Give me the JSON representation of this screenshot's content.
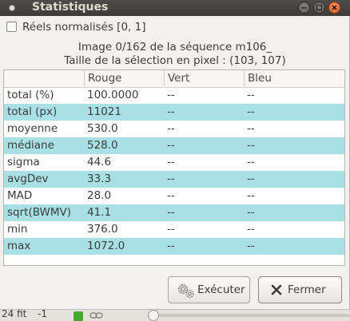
{
  "window": {
    "title": "Statistiques"
  },
  "options": {
    "normalized_label": "Réels normalisés [0, 1]",
    "normalized_checked": false
  },
  "info": {
    "image_line": "Image 0/162 de la séquence m106_",
    "selection_line": "Taille de la sélection en pixel : (103, 107)"
  },
  "table": {
    "headers": [
      "",
      "Rouge",
      "Vert",
      "Bleu"
    ],
    "rows": [
      [
        "total (%)",
        "100.0000",
        "--",
        "--"
      ],
      [
        "total (px)",
        "11021",
        "--",
        "--"
      ],
      [
        "moyenne",
        "530.0",
        "--",
        "--"
      ],
      [
        "médiane",
        "528.0",
        "--",
        "--"
      ],
      [
        "sigma",
        "44.6",
        "--",
        "--"
      ],
      [
        "avgDev",
        "33.3",
        "--",
        "--"
      ],
      [
        "MAD",
        "28.0",
        "--",
        "--"
      ],
      [
        "sqrt(BWMV)",
        "41.1",
        "--",
        "--"
      ],
      [
        "min",
        "376.0",
        "--",
        "--"
      ],
      [
        "max",
        "1072.0",
        "--",
        "--"
      ]
    ]
  },
  "buttons": {
    "execute_label": "Exécuter",
    "close_label": "Fermer"
  },
  "statusbar": {
    "fit_label": "24 fit",
    "minus_label": "-1"
  },
  "colors": {
    "row_highlight": "#a8e0e5",
    "titlebar": "#3d3c39",
    "close_button": "#e2571e"
  },
  "icons": [
    "app-dot-icon",
    "minimize-icon",
    "maximize-icon",
    "close-icon",
    "gears-icon",
    "x-icon",
    "green-check-icon",
    "link-icon"
  ]
}
